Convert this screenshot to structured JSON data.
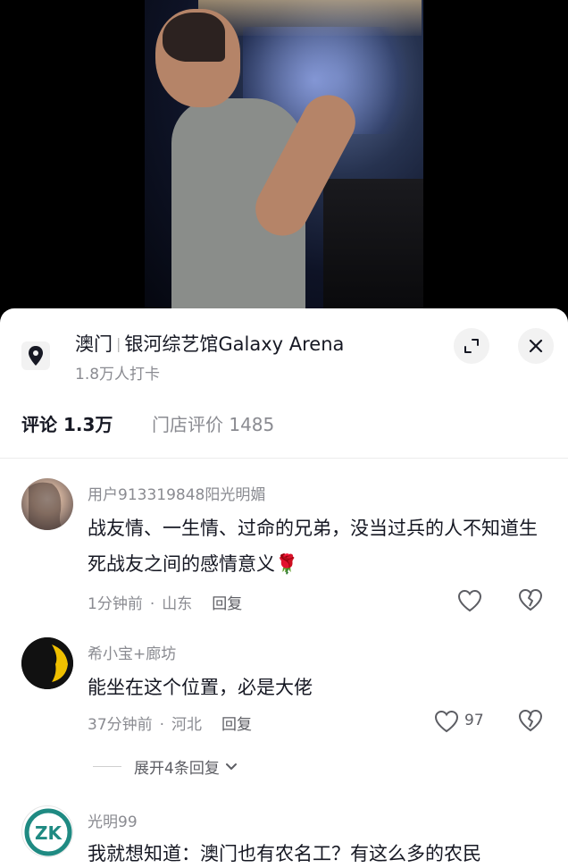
{
  "location": {
    "city": "澳门",
    "venue": "银河综艺馆Galaxy Arena",
    "checkins": "1.8万人打卡"
  },
  "tabs": [
    {
      "label": "评论 1.3万"
    },
    {
      "label": "门店评价 1485"
    }
  ],
  "comments": [
    {
      "user": "用户913319848阳光明媚",
      "text": "战友情、一生情、过命的兄弟，没当过兵的人不知道生死战友之间的感情意义",
      "emoji": "🌹",
      "time": "1分钟前",
      "region": "山东",
      "reply": "回复",
      "likes": ""
    },
    {
      "user": "希小宝+廊坊",
      "text": "能坐在这个位置，必是大佬",
      "time": "37分钟前",
      "region": "河北",
      "reply": "回复",
      "likes": "97"
    },
    {
      "user": "光明99",
      "text": "我就想知道：澳门也有农名工？有这么多的农民"
    }
  ],
  "expand_replies": "展开4条回复",
  "colors": {
    "primary_text": "#161823",
    "secondary_text": "#8a8b91",
    "sheet_bg": "#ffffff"
  }
}
